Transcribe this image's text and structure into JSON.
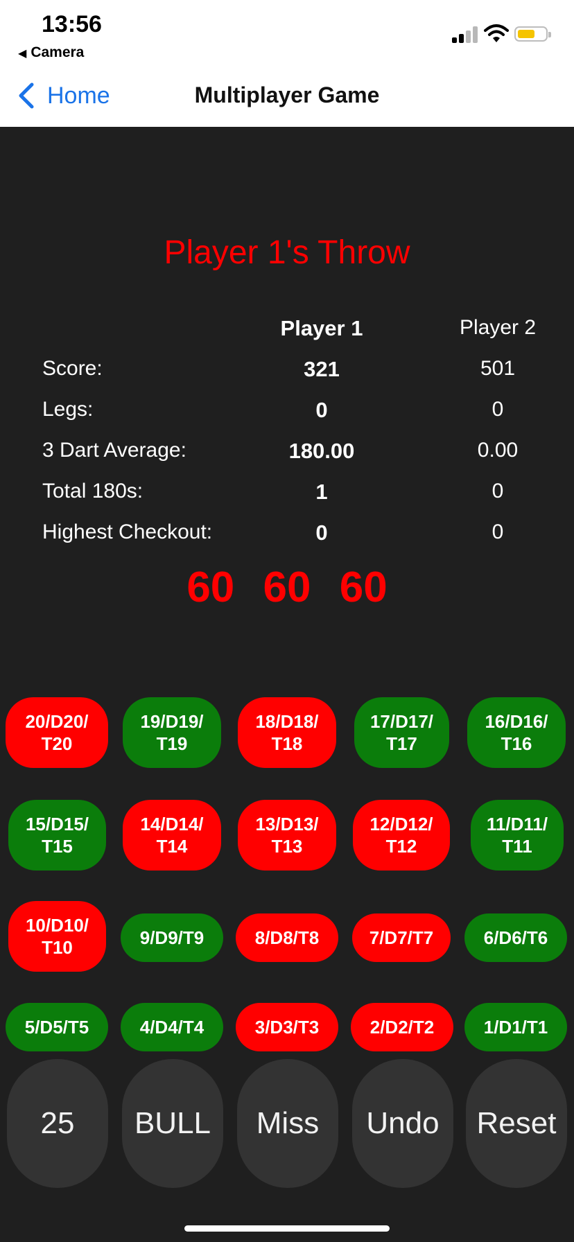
{
  "status_bar": {
    "time": "13:56",
    "back_app": "Camera"
  },
  "nav": {
    "back_label": "Home",
    "title": "Multiplayer Game"
  },
  "turn_label": "Player 1's Throw",
  "stats": {
    "headers": {
      "player1": "Player 1",
      "player2": "Player 2"
    },
    "rows": [
      {
        "label": "Score:",
        "p1": "321",
        "p2": "501"
      },
      {
        "label": "Legs:",
        "p1": "0",
        "p2": "0"
      },
      {
        "label": "3 Dart Average:",
        "p1": "180.00",
        "p2": "0.00"
      },
      {
        "label": "Total 180s:",
        "p1": "1",
        "p2": "0"
      },
      {
        "label": "Highest Checkout:",
        "p1": "0",
        "p2": "0"
      }
    ]
  },
  "current_darts": [
    "60",
    "60",
    "60"
  ],
  "score_buttons": [
    [
      "20/D20/\nT20",
      "19/D19/\nT19",
      "18/D18/\nT18",
      "17/D17/\nT17",
      "16/D16/\nT16"
    ],
    [
      "15/D15/\nT15",
      "14/D14/\nT14",
      "13/D13/\nT13",
      "12/D12/\nT12",
      "11/D11/\nT11"
    ],
    [
      "10/D10/\nT10",
      "9/D9/T9",
      "8/D8/T8",
      "7/D7/T7",
      "6/D6/T6"
    ],
    [
      "5/D5/T5",
      "4/D4/T4",
      "3/D3/T3",
      "2/D2/T2",
      "1/D1/T1"
    ]
  ],
  "action_buttons": [
    "25",
    "BULL",
    "Miss",
    "Undo",
    "Reset"
  ],
  "colors": {
    "red": "#ff0000",
    "green": "#0b7d0b",
    "link": "#1a73e8",
    "background": "#1f1f1f"
  }
}
